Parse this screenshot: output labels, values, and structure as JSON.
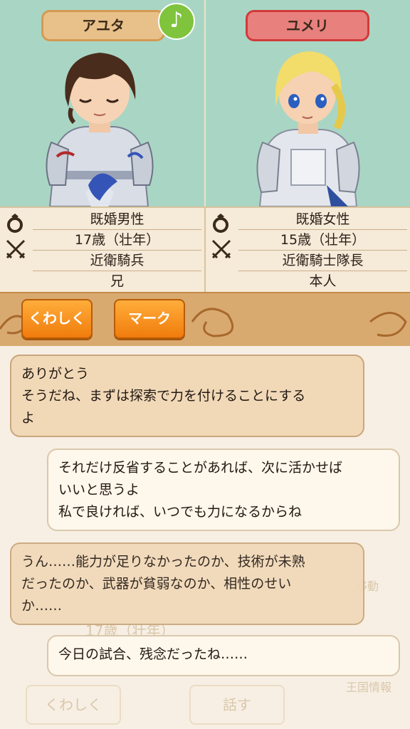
{
  "left": {
    "name": "アユタ",
    "music_note": "♪",
    "info": [
      "既婚男性",
      "17歳（壮年）",
      "近衛騎兵",
      "兄"
    ]
  },
  "right": {
    "name": "ユメリ",
    "info": [
      "既婚女性",
      "15歳（壮年）",
      "近衛騎士隊長",
      "本人"
    ]
  },
  "buttons": {
    "details": "くわしく",
    "mark": "マーク"
  },
  "chat": [
    {
      "speaker": "left",
      "lines": [
        "ありがとう",
        "そうだね、まずは探索で力を付けることにする",
        "よ"
      ]
    },
    {
      "speaker": "right",
      "lines": [
        "それだけ反省することがあれば、次に活かせば",
        "いいと思うよ",
        "私で良ければ、いつでも力になるからね"
      ]
    },
    {
      "speaker": "left",
      "lines": [
        "うん……能力が足りなかったのか、技術が未熟",
        "だったのか、武器が貧弱なのか、相性のせい",
        "か……"
      ]
    },
    {
      "speaker": "right",
      "lines": [
        "今日の試合、残念だったね……"
      ]
    }
  ],
  "background": {
    "age_text": "17歳（壮年）",
    "details_button": "くわしく",
    "talk_button": "話す",
    "move_label": "移動",
    "kingdom_label": "王国情報"
  },
  "colors": {
    "male_pill": "#e8c08a",
    "female_pill": "#e8807e",
    "panel_bg": "#a9d6c4",
    "button": "#f59a22"
  }
}
